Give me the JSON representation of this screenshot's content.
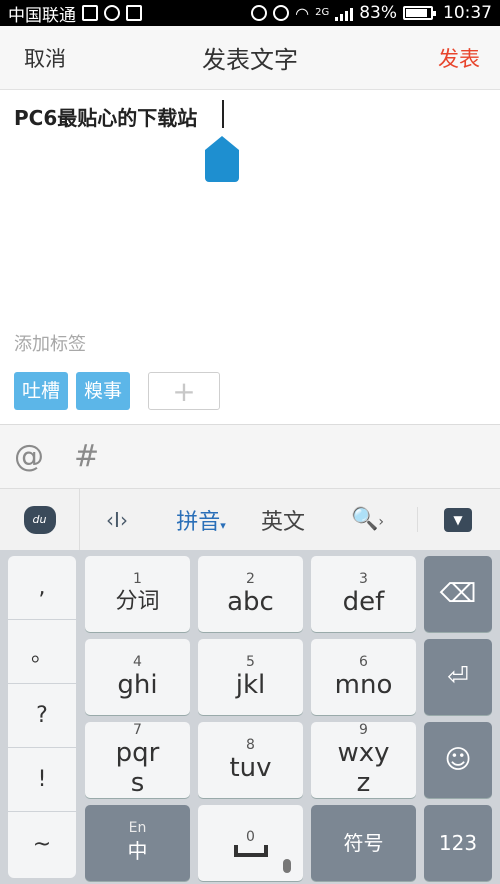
{
  "status_bar": {
    "carrier": "中国联通",
    "net_type": "2G",
    "battery": "83%",
    "time": "10:37",
    "icons": [
      "image-icon",
      "alarm-icon",
      "notification-icon",
      "du-icon",
      "clock-icon",
      "wifi-icon",
      "signal-icon",
      "battery-icon"
    ]
  },
  "header": {
    "cancel": "取消",
    "title": "发表文字",
    "publish": "发表"
  },
  "editor": {
    "text": "PC6最贴心的下载站"
  },
  "tags": {
    "label": "添加标签",
    "items": [
      "吐槽",
      "糗事"
    ],
    "add_glyph": "+"
  },
  "toolbar": {
    "at": "@",
    "hash": "#"
  },
  "ime_bar": {
    "cursor_glyph": "‹I›",
    "mode": "拼音",
    "mode_arrow": "▾",
    "english": "英文",
    "search_glyph": "🔍",
    "chevron": "›"
  },
  "keyboard": {
    "punct": [
      ",",
      "。",
      "?",
      "!",
      "~"
    ],
    "keys": [
      {
        "num": "1",
        "main": "分词"
      },
      {
        "num": "2",
        "main": "abc"
      },
      {
        "num": "3",
        "main": "def"
      },
      {
        "num": "4",
        "main": "ghi"
      },
      {
        "num": "5",
        "main": "jkl"
      },
      {
        "num": "6",
        "main": "mno"
      },
      {
        "num": "7",
        "main": "pqr\ns"
      },
      {
        "num": "8",
        "main": "tuv"
      },
      {
        "num": "9",
        "main": "wxy\nz"
      }
    ],
    "lang_small": "En",
    "lang_main": "中",
    "zero": "0",
    "symbols": "符号",
    "numbers": "123",
    "backspace": "⌫",
    "enter": "⏎",
    "emoji": "☺"
  }
}
